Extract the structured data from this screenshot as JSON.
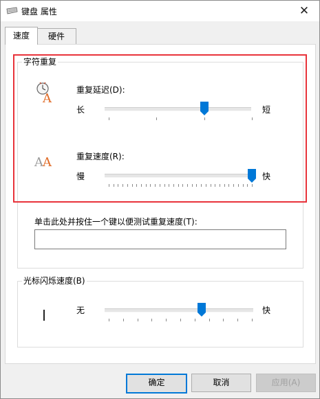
{
  "window": {
    "title": "键盘 属性"
  },
  "tabs": [
    {
      "label": "速度",
      "active": true
    },
    {
      "label": "硬件",
      "active": false
    }
  ],
  "repeat_group": {
    "label": "字符重复",
    "delay": {
      "label": "重复延迟(D):",
      "min_label": "长",
      "max_label": "短",
      "value_fraction": 0.67
    },
    "rate": {
      "label": "重复速度(R):",
      "min_label": "慢",
      "max_label": "快",
      "value_fraction": 1.0
    }
  },
  "test": {
    "label": "单击此处并按住一个键以便测试重复速度(T):",
    "value": ""
  },
  "cursor_group": {
    "label": "光标闪烁速度(B)",
    "min_label": "无",
    "max_label": "快",
    "value_fraction": 0.65
  },
  "buttons": {
    "ok": "确定",
    "cancel": "取消",
    "apply": "应用(A)"
  },
  "colors": {
    "accent": "#0078d7",
    "highlight_border": "#e8323a"
  }
}
